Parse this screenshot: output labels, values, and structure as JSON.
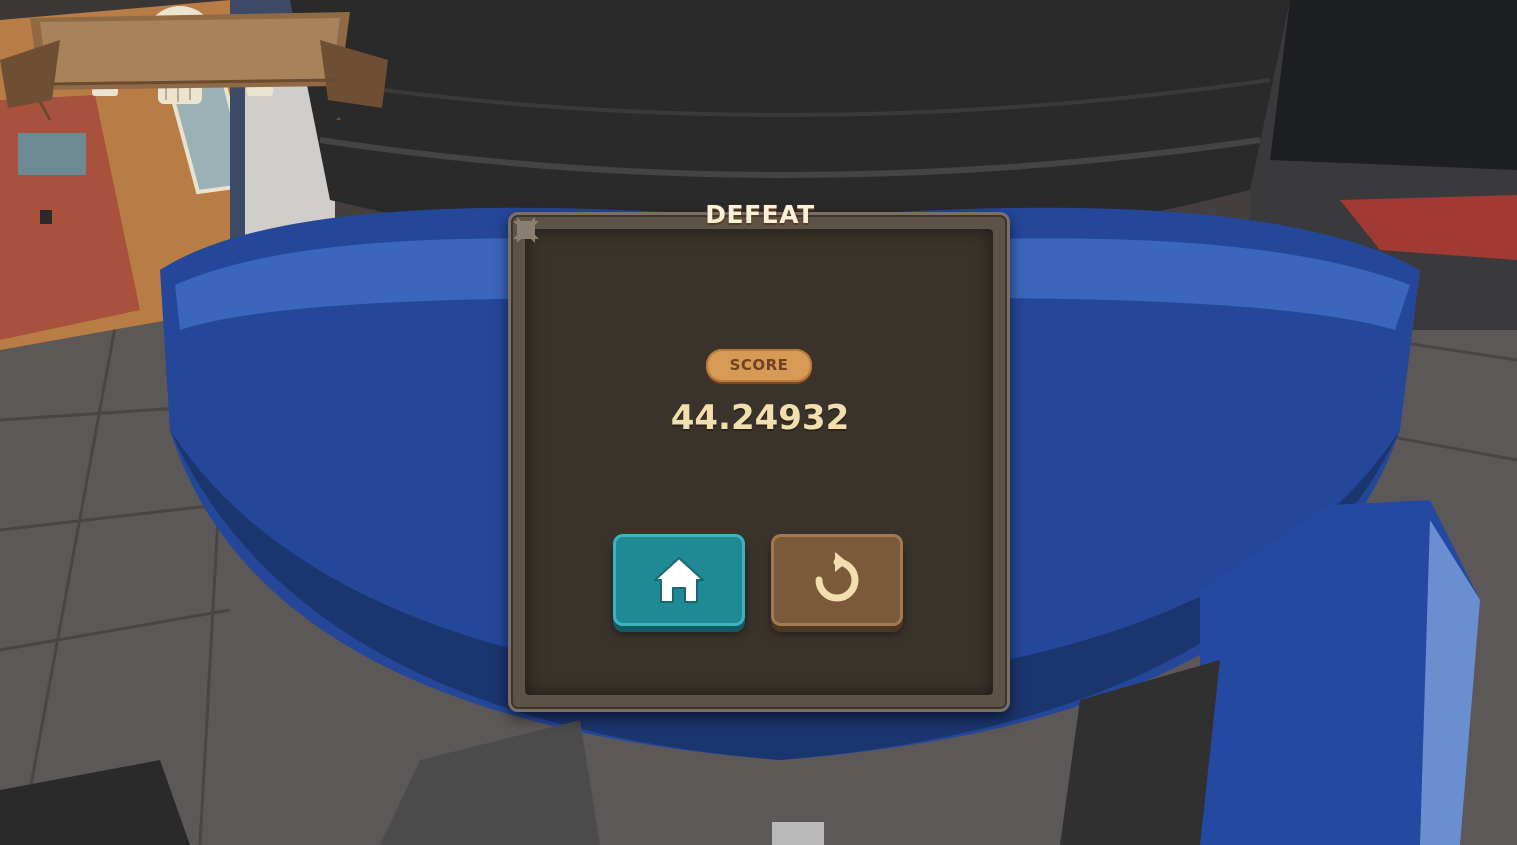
{
  "popup": {
    "title": "DEFEAT",
    "score_label": "SCORE",
    "score_value": "44.24932"
  },
  "buttons": {
    "home_icon": "home-icon",
    "retry_icon": "restart-icon"
  },
  "colors": {
    "home_button": "#1f8a96",
    "retry_button": "#7b5a3a",
    "title_text": "#fbf0d8",
    "score_text": "#f3dfae",
    "score_pill": "#d69a55"
  }
}
